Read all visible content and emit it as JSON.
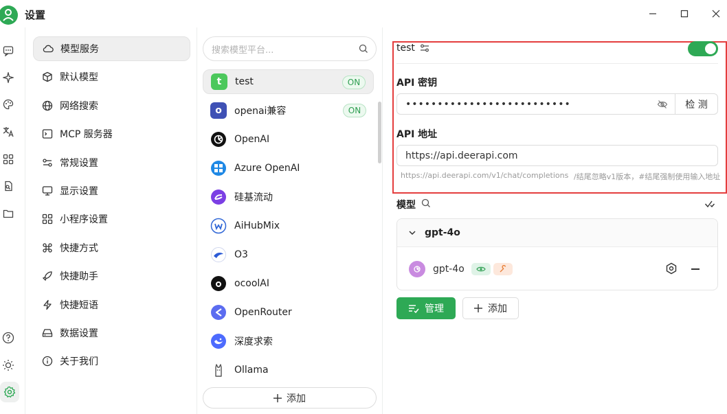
{
  "window": {
    "title": "设置"
  },
  "nav": {
    "items": [
      {
        "label": "模型服务",
        "icon": "cloud-icon",
        "active": true
      },
      {
        "label": "默认模型",
        "icon": "cube-icon"
      },
      {
        "label": "网络搜索",
        "icon": "globe-icon"
      },
      {
        "label": "MCP 服务器",
        "icon": "terminal-icon"
      },
      {
        "label": "常规设置",
        "icon": "sliders-icon"
      },
      {
        "label": "显示设置",
        "icon": "monitor-icon"
      },
      {
        "label": "小程序设置",
        "icon": "grid-icon"
      },
      {
        "label": "快捷方式",
        "icon": "command-icon"
      },
      {
        "label": "快捷助手",
        "icon": "rocket-icon"
      },
      {
        "label": "快捷短语",
        "icon": "zap-icon"
      },
      {
        "label": "数据设置",
        "icon": "hard-drive-icon"
      },
      {
        "label": "关于我们",
        "icon": "info-icon"
      }
    ]
  },
  "providers": {
    "search_placeholder": "搜索模型平台...",
    "items": [
      {
        "name": "test",
        "logo_letter": "t",
        "logo_color": "#4cc85c",
        "on": true,
        "active": true
      },
      {
        "name": "openai兼容",
        "logo_letter": "o",
        "logo_color": "#3f51b5",
        "on": true
      },
      {
        "name": "OpenAI",
        "logo_color": "#111111"
      },
      {
        "name": "Azure OpenAI",
        "logo_color": "#1e88e5"
      },
      {
        "name": "硅基流动",
        "logo_color": "#7b3fe4"
      },
      {
        "name": "AiHubMix",
        "logo_color": "#2f66d6"
      },
      {
        "name": "O3",
        "logo_color": "#2c5bd6"
      },
      {
        "name": "ocoolAI",
        "logo_color": "#111111"
      },
      {
        "name": "OpenRouter",
        "logo_color": "#5b6cf0"
      },
      {
        "name": "深度求索",
        "logo_color": "#4d6bfe"
      },
      {
        "name": "Ollama",
        "logo_color": "#555555"
      }
    ],
    "on_label": "ON",
    "add_label": "添加"
  },
  "detail": {
    "provider_name": "test",
    "enabled": true,
    "api_key_label": "API 密钥",
    "api_key_value": "••••••••••••••••••••••••••",
    "check_label": "检 测",
    "api_url_label": "API 地址",
    "api_url_value": "https://api.deerapi.com",
    "hint_url": "https://api.deerapi.com/v1/chat/completions",
    "hint_note": "/结尾忽略v1版本，#结尾强制使用输入地址",
    "models_label": "模型",
    "group_title": "gpt-4o",
    "model_name": "gpt-4o",
    "manage_label": "管理",
    "add_label": "添加"
  },
  "colors": {
    "accent": "#2ea955",
    "highlight_border": "#e43d3d"
  }
}
